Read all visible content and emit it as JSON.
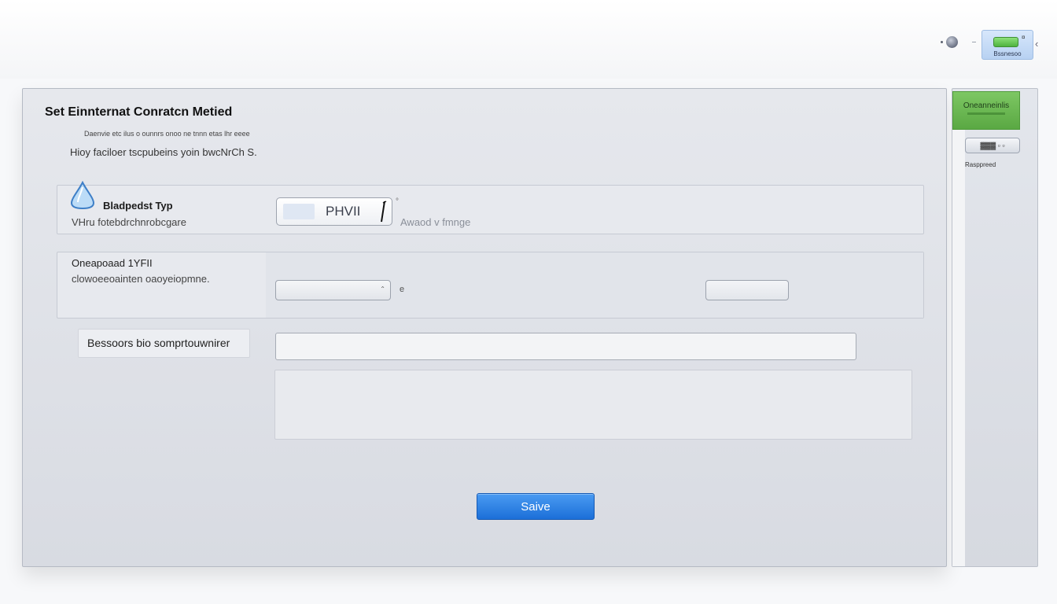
{
  "topbar": {
    "globe_icon": "globe-icon",
    "status_label": "Bssnesoo",
    "status_mark": "¤",
    "chevron": "‹"
  },
  "dialog": {
    "title": "Set Einnternat Conratcn Metied",
    "subtitle": "Daenvie etc ilus o ounnrs onoo ne tnnn etas lhr eeee",
    "description": "Hioy faciloer tscpubeins yoin bwcNrCh S."
  },
  "section_mode": {
    "icon": "drop-icon",
    "label": "Bladpedst Typ",
    "help": "VHru fotebdrchnrobcgare",
    "field_value": "PHVII",
    "mark": "°",
    "hint": "Awaod v fmnge"
  },
  "section_options": {
    "label": "Oneapoaad 1YFII",
    "help": "clowoeeoainten oaoyeiopmne.",
    "mark": "e"
  },
  "browse": {
    "button_label": "Bessoors bio somprtouwnirer",
    "path_value": ""
  },
  "actions": {
    "save_label": "Saive"
  },
  "side": {
    "green_label": "Oneanneinlis",
    "chip_label": "▓▓▓ ▫ ▫",
    "label": "Rasppreed"
  },
  "colors": {
    "accent": "#1c6fd8",
    "status_green": "#5aa843",
    "panel_bg": "#e6e8ed"
  }
}
